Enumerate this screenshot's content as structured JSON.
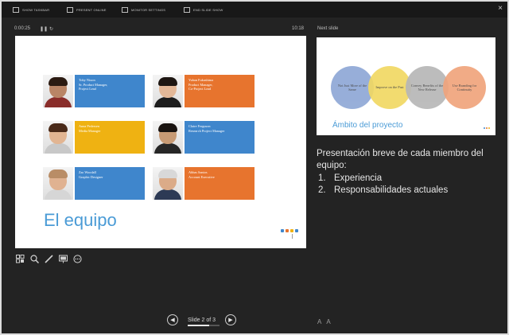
{
  "toolbar": {
    "items": [
      "SHOW TASKBAR",
      "PRESENT ONLINE",
      "MONITOR SETTINGS",
      "END SLIDE SHOW"
    ],
    "close": "×"
  },
  "timer": "0:00:25",
  "clock": "10:18",
  "next_slide_label": "Next slide",
  "current_slide": {
    "title": "El equipo",
    "members": [
      {
        "lines": [
          "Toby Nixon",
          "Sr. Product Manager,",
          "Project Lead"
        ],
        "color": "#3f86cc",
        "skin": "#b98566",
        "hair": "#2b1b12",
        "shirt": "#8a2d2a"
      },
      {
        "lines": [
          "Yuhan Fukushima",
          "Product Manager,",
          "Co-Project Lead"
        ],
        "color": "#e7742e",
        "skin": "#e3b898",
        "hair": "#1e1713",
        "shirt": "#1d1d1d"
      },
      {
        "lines": [
          "Anna Pedersen",
          "Media Manager"
        ],
        "color": "#efb212",
        "skin": "#e2b592",
        "hair": "#4a2a19",
        "shirt": "#c8c8c8"
      },
      {
        "lines": [
          "Claire Ferguson",
          "Research Project Manager"
        ],
        "color": "#3f86cc",
        "skin": "#c89b75",
        "hair": "#1a1411",
        "shirt": "#262626"
      },
      {
        "lines": [
          "Zac Woodall",
          "Graphic Designer"
        ],
        "color": "#3f86cc",
        "skin": "#e0b291",
        "hair": "#b98d66",
        "shirt": "#d6d6d6"
      },
      {
        "lines": [
          "Abbas Santos",
          "Account Executive"
        ],
        "color": "#e7742e",
        "skin": "#dbab88",
        "hair": "#d8d8d8",
        "shirt": "#2d3a55"
      }
    ]
  },
  "next_slide": {
    "title": "Ámbito del proyecto",
    "circles": [
      {
        "text": "Not Just More of the Same",
        "color": "#8fa8d6"
      },
      {
        "text": "Improve on the Past",
        "color": "#f1d863"
      },
      {
        "text": "Convey Benefits of the New Release",
        "color": "#b7b7b7"
      },
      {
        "text": "Use Branding for Continuity",
        "color": "#f0a47c"
      }
    ]
  },
  "notes": {
    "intro": "Presentación breve de cada miembro del equipo:",
    "items": [
      "Experiencia",
      "Responsabilidades actuales"
    ]
  },
  "navigation": {
    "slide_count": "Slide 2 of 3",
    "progress": 0.67
  },
  "colors": {
    "background": "#232323",
    "accent_blue": "#4a9bd6"
  }
}
